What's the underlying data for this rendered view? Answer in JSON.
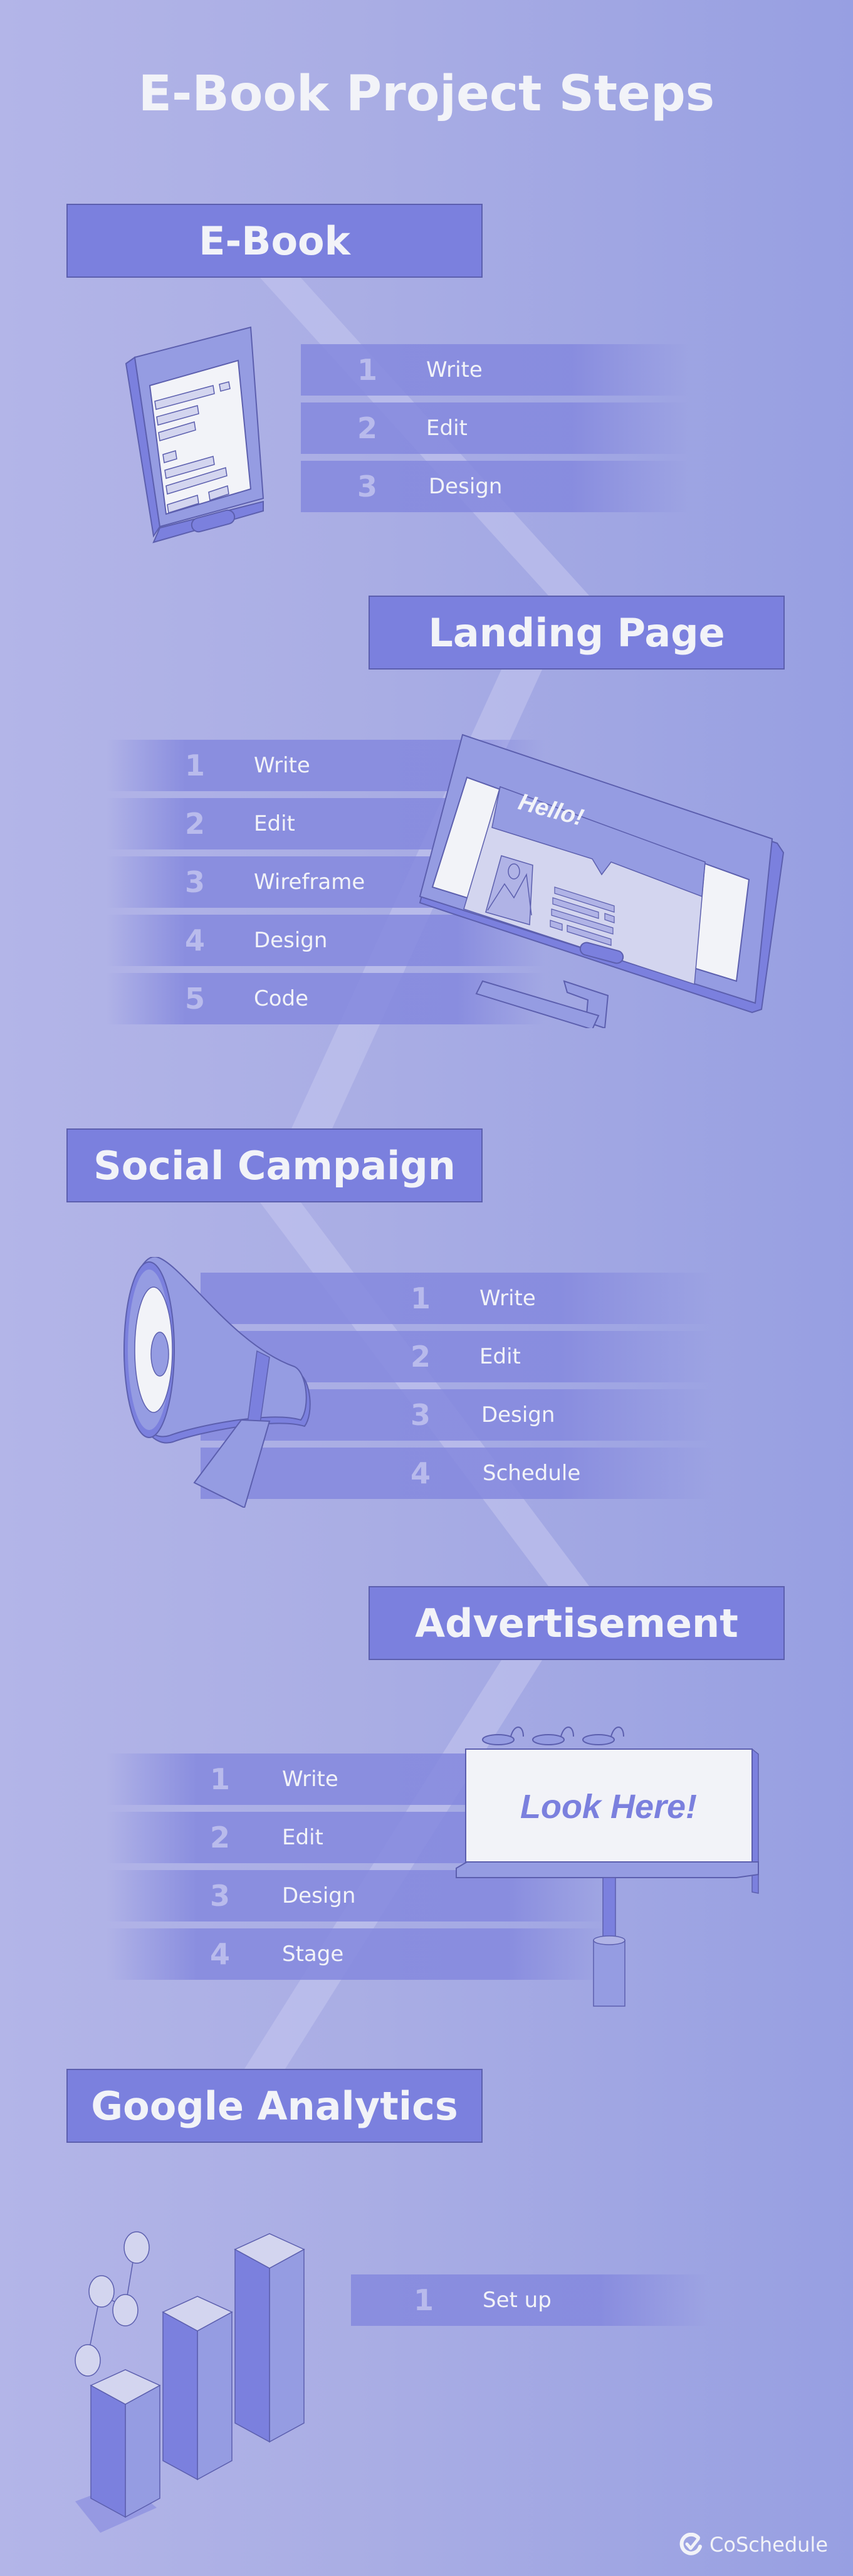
{
  "title": "E-Book Project Steps",
  "sections": [
    {
      "heading": "E-Book",
      "illustration": "tablet-icon",
      "steps": [
        {
          "number": "1",
          "label": "Write"
        },
        {
          "number": "2",
          "label": "Edit"
        },
        {
          "number": "3",
          "label": "Design"
        }
      ]
    },
    {
      "heading": "Landing Page",
      "illustration": "monitor-icon",
      "screen_text": "Hello!",
      "steps": [
        {
          "number": "1",
          "label": "Write"
        },
        {
          "number": "2",
          "label": "Edit"
        },
        {
          "number": "3",
          "label": "Wireframe"
        },
        {
          "number": "4",
          "label": "Design"
        },
        {
          "number": "5",
          "label": "Code"
        }
      ]
    },
    {
      "heading": "Social Campaign",
      "illustration": "megaphone-icon",
      "steps": [
        {
          "number": "1",
          "label": "Write"
        },
        {
          "number": "2",
          "label": "Edit"
        },
        {
          "number": "3",
          "label": "Design"
        },
        {
          "number": "4",
          "label": "Schedule"
        }
      ]
    },
    {
      "heading": "Advertisement",
      "illustration": "billboard-icon",
      "billboard_text": "Look Here!",
      "steps": [
        {
          "number": "1",
          "label": "Write"
        },
        {
          "number": "2",
          "label": "Edit"
        },
        {
          "number": "3",
          "label": "Design"
        },
        {
          "number": "4",
          "label": "Stage"
        }
      ]
    },
    {
      "heading": "Google Analytics",
      "illustration": "bar-chart-icon",
      "steps": [
        {
          "number": "1",
          "label": "Set up"
        }
      ]
    }
  ],
  "brand": {
    "name": "CoSchedule",
    "icon": "coschedule-check-icon"
  },
  "colors": {
    "header_bg": "#7b80de",
    "text": "#f2f3f8",
    "bar": "#8488de",
    "background_light": "#b3b5e8",
    "background_dark": "#979fe2"
  }
}
